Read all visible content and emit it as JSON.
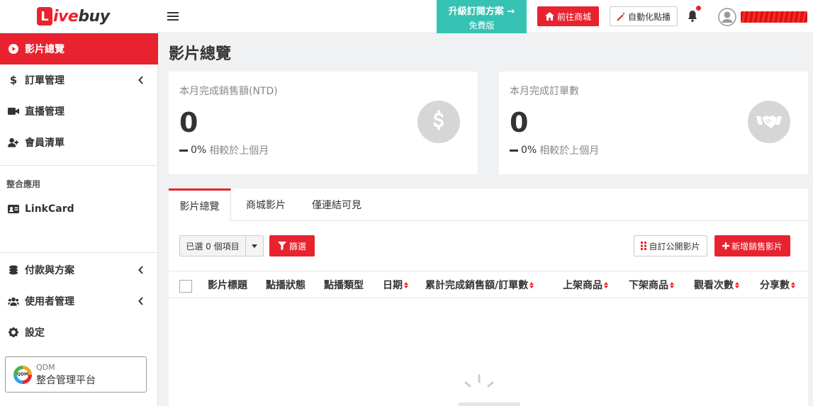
{
  "header": {
    "logo_letter": "L",
    "logo_mid": "ive",
    "logo_end": "buy",
    "upgrade_label": "升級訂閱方案",
    "upgrade_arrow": "→",
    "plan_label": "免費版",
    "shop_button": "前往商城",
    "auto_button": "自動化點播"
  },
  "sidebar": {
    "items": [
      {
        "label": "影片總覽",
        "icon": "play-circle-icon"
      },
      {
        "label": "訂單管理",
        "icon": "dollar-icon"
      },
      {
        "label": "直播管理",
        "icon": "video-camera-icon"
      },
      {
        "label": "會員清單",
        "icon": "user-plus-icon"
      }
    ],
    "section_label": "整合應用",
    "linkcard_label": "LinkCard",
    "bottom_items": [
      {
        "label": "付款與方案",
        "icon": "coins-icon"
      },
      {
        "label": "使用者管理",
        "icon": "users-icon"
      },
      {
        "label": "設定",
        "icon": "gear-icon"
      }
    ],
    "qdm_logo": "QDM",
    "qdm_title": "QDM",
    "qdm_subtitle": "整合管理平台"
  },
  "main": {
    "page_title": "影片總覽",
    "stats": [
      {
        "label": "本月完成銷售額(NTD)",
        "value": "0",
        "percent": "0%",
        "compare": "相較於上個月"
      },
      {
        "label": "本月完成訂單數",
        "value": "0",
        "percent": "0%",
        "compare": "相較於上個月"
      }
    ],
    "tabs": [
      "影片總覽",
      "商城影片",
      "僅連結可見"
    ],
    "selected_label": "已選 0 個項目",
    "filter_button": "篩選",
    "custom_public_button": "自訂公開影片",
    "new_video_button": "新增銷售影片",
    "columns": [
      "影片標題",
      "點播狀態",
      "點播類型",
      "日期",
      "累計完成銷售額/訂單數",
      "上架商品",
      "下架商品",
      "觀看次數",
      "分享數"
    ]
  },
  "colors": {
    "brand_red": "#e8222f",
    "teal": "#36c2b3"
  }
}
